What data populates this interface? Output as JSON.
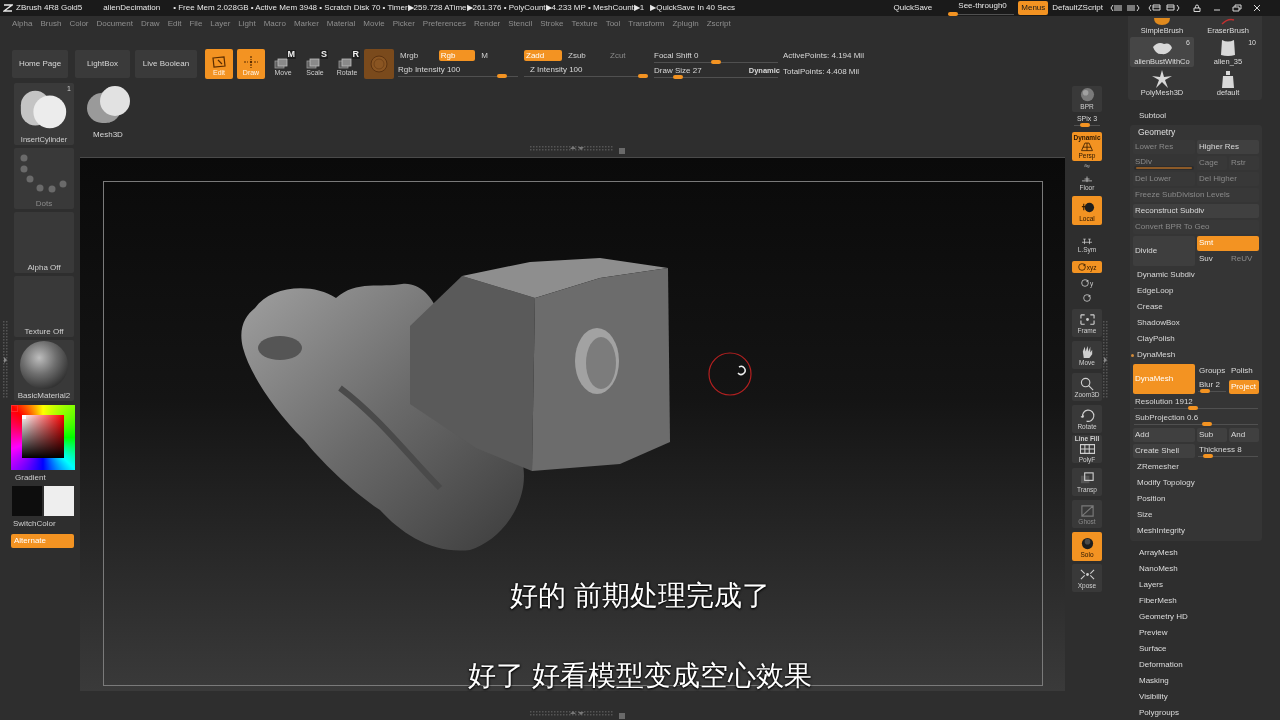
{
  "title_bar": {
    "app": "ZBrush 4R8 Gold5",
    "document": "alienDecimation",
    "stats": "• Free Mem 2.028GB • Active Mem 3948 • Scratch Disk 70 • Timer▶259.728 ATime▶261.376 • PolyCount▶4.233 MP • MeshCount▶1",
    "autosave": "▶QuickSave In 40 Secs",
    "quicksave": "QuickSave",
    "see_through": {
      "label": "See-through",
      "value": "0",
      "level": 0
    },
    "menus": {
      "label": "Menus",
      "on": true
    },
    "script": "DefaultZScript"
  },
  "menu_bar": [
    "Alpha",
    "Brush",
    "Color",
    "Document",
    "Draw",
    "Edit",
    "File",
    "Layer",
    "Light",
    "Macro",
    "Marker",
    "Material",
    "Movie",
    "Picker",
    "Preferences",
    "Render",
    "Stencil",
    "Stroke",
    "Texture",
    "Tool",
    "Transform",
    "Zplugin",
    "Zscript"
  ],
  "top_shelf": {
    "buttons": [
      "Home Page",
      "LightBox",
      "Live Boolean"
    ],
    "modes": [
      {
        "label": "Edit",
        "kind": "edit",
        "on": true
      },
      {
        "label": "Draw",
        "kind": "draw",
        "on": true
      },
      {
        "label": "Move",
        "kind": "move",
        "badge": "M",
        "on": false
      },
      {
        "label": "Scale",
        "kind": "scale",
        "badge": "S",
        "on": false
      },
      {
        "label": "Rotate",
        "kind": "rotate",
        "badge": "R",
        "on": false
      }
    ],
    "color_modes": [
      {
        "label": "Mrgb",
        "on": false,
        "disabled": false
      },
      {
        "label": "Rgb",
        "on": true,
        "disabled": false
      },
      {
        "label": "M",
        "on": false,
        "disabled": false
      }
    ],
    "rgb_intensity": {
      "label": "Rgb Intensity 100",
      "level": 0.9
    },
    "z_modes": [
      {
        "label": "Zadd",
        "on": true,
        "disabled": false
      },
      {
        "label": "Zsub",
        "on": false,
        "disabled": false
      },
      {
        "label": "Zcut",
        "on": false,
        "disabled": true
      }
    ],
    "z_intensity": {
      "label": "Z Intensity 100",
      "level": 1
    },
    "focal_shift": {
      "label": "Focal Shift 0",
      "level": 0.5
    },
    "draw_size": {
      "label": "Draw Size 27",
      "tag": "Dynamic",
      "level": 0.17
    },
    "stats": [
      "ActivePoints: 4.194 Mil",
      "TotalPoints: 4.408 Mil"
    ]
  },
  "brush": {
    "label": "InsertCylinder",
    "count": "1"
  },
  "tool": {
    "label": "Mesh3D"
  },
  "left_tray": {
    "stroke": "Dots",
    "alpha": "Alpha Off",
    "texture": "Texture Off",
    "material": "BasicMaterial2",
    "gradient": "Gradient",
    "swatches": [
      {
        "color": "#0d0d0d"
      },
      {
        "color": "#eeeeee"
      }
    ],
    "switch_color": "SwitchColor",
    "alternate": {
      "label": "Alternate",
      "on": true
    }
  },
  "canvas": {
    "subtitles": [
      "好的 前期处理完成了",
      "好了 好看模型变成空心效果"
    ]
  },
  "right_shelf": [
    {
      "kind": "bpr",
      "label": "BPR",
      "on": false,
      "disabled": false
    },
    {
      "kind": "slider",
      "label": "SPix 3",
      "level": 0.35
    },
    {
      "kind": "persp",
      "tag": "Dynamic",
      "label": "Persp",
      "on": true,
      "disabled": false
    },
    {
      "kind": "mini",
      "on": false,
      "disabled": false
    },
    {
      "kind": "floor",
      "label": "Floor",
      "on": false,
      "disabled": false
    },
    {
      "kind": "local",
      "label": "Local",
      "on": true,
      "disabled": false
    },
    {
      "kind": "lsym",
      "label": "L.Sym",
      "on": false,
      "disabled": false
    },
    {
      "kind": "xyz",
      "label": "xyz",
      "on": true,
      "disabled": false
    },
    {
      "kind": "y",
      "label": "y",
      "on": false,
      "disabled": false
    },
    {
      "kind": "z",
      "on": false,
      "disabled": false
    },
    {
      "kind": "frame",
      "label": "Frame",
      "on": false,
      "disabled": false
    },
    {
      "kind": "move",
      "label": "Move",
      "on": false,
      "disabled": false
    },
    {
      "kind": "zoom",
      "label": "Zoom3D",
      "on": false,
      "disabled": false
    },
    {
      "kind": "rotate",
      "label": "Rotate",
      "on": false,
      "disabled": false
    },
    {
      "kind": "polyf",
      "tag": "Line Fill",
      "label": "PolyF",
      "on": false,
      "disabled": false
    },
    {
      "kind": "transp",
      "label": "Transp",
      "on": false,
      "disabled": false
    },
    {
      "kind": "ghost",
      "label": "Ghost",
      "on": false,
      "disabled": true
    },
    {
      "kind": "solo",
      "label": "Solo",
      "on": true,
      "disabled": false
    },
    {
      "kind": "xpose",
      "label": "Xpose",
      "on": false,
      "disabled": false
    }
  ],
  "tool_palette": [
    {
      "label": "SimpleBrush",
      "kind": "simple_brush",
      "selected": false
    },
    {
      "label": "EraserBrush",
      "kind": "eraser",
      "selected": false
    },
    {
      "label": "alienBustWithCo",
      "count": "6",
      "kind": "bust",
      "selected": true
    },
    {
      "label": "alien_35",
      "count": "10",
      "kind": "torso",
      "selected": false
    },
    {
      "label": "PolyMesh3D",
      "kind": "star",
      "selected": false
    },
    {
      "label": "default",
      "kind": "figure",
      "selected": false
    }
  ],
  "subtool": "Subtool",
  "geometry": {
    "title": "Geometry",
    "rows": [
      {
        "kind": "cells",
        "cells": [
          {
            "kind": "button",
            "label": "Lower Res",
            "on": false,
            "disabled": true
          },
          {
            "kind": "button",
            "label": "Higher Res",
            "on": false,
            "disabled": false
          }
        ]
      },
      {
        "kind": "cells",
        "cells": [
          {
            "kind": "slider",
            "label": "SDiv",
            "level": 1,
            "disabled": true
          },
          {
            "kind": "button",
            "label": "Cage",
            "on": false,
            "disabled": true
          },
          {
            "kind": "button",
            "label": "Rstr",
            "on": false,
            "disabled": true
          }
        ]
      },
      {
        "kind": "cells",
        "cells": [
          {
            "kind": "button",
            "label": "Del Lower",
            "on": false,
            "disabled": true
          },
          {
            "kind": "button",
            "label": "Del Higher",
            "on": false,
            "disabled": true
          }
        ]
      },
      {
        "kind": "cells",
        "cells": [
          {
            "kind": "button",
            "label": "Freeze SubDivision Levels",
            "on": false,
            "disabled": true
          }
        ]
      },
      {
        "kind": "cells",
        "cells": [
          {
            "kind": "button",
            "label": "Reconstruct Subdiv",
            "on": false,
            "disabled": false
          }
        ]
      },
      {
        "kind": "cells",
        "cells": [
          {
            "kind": "button",
            "label": "Convert BPR To Geo",
            "on": false,
            "disabled": true
          }
        ]
      },
      {
        "kind": "block",
        "main": {
          "label": "Divide",
          "on": false,
          "disabled": false
        },
        "top": [
          {
            "kind": "toggle",
            "label": "Smt",
            "on": true,
            "disabled": false
          }
        ],
        "bottom": [
          {
            "kind": "toggle",
            "label": "Suv",
            "on": false,
            "disabled": false
          },
          {
            "kind": "toggle",
            "label": "ReUV",
            "on": false,
            "disabled": true
          }
        ]
      },
      {
        "kind": "subpalette",
        "label": "Dynamic Subdiv",
        "expanded": false
      },
      {
        "kind": "subpalette",
        "label": "EdgeLoop",
        "expanded": false
      },
      {
        "kind": "subpalette",
        "label": "Crease",
        "expanded": false
      },
      {
        "kind": "subpalette",
        "label": "ShadowBox",
        "expanded": false
      },
      {
        "kind": "subpalette",
        "label": "ClayPolish",
        "expanded": false
      },
      {
        "kind": "subpalette",
        "label": "DynaMesh",
        "expanded": true
      },
      {
        "kind": "block",
        "main": {
          "label": "DynaMesh",
          "on": true,
          "disabled": false
        },
        "top": [
          {
            "kind": "toggle",
            "label": "Groups",
            "on": false,
            "disabled": false
          },
          {
            "kind": "toggle",
            "label": "Polish",
            "on": false,
            "disabled": false
          }
        ],
        "bottom": [
          {
            "kind": "slider",
            "label": "Blur 2",
            "level": 0.1,
            "disabled": false
          },
          {
            "kind": "toggle",
            "label": "Project",
            "on": true,
            "disabled": false
          }
        ]
      },
      {
        "kind": "cells",
        "cells": [
          {
            "kind": "slider",
            "label": "Resolution 1912",
            "level": 0.47,
            "disabled": false
          }
        ]
      },
      {
        "kind": "cells",
        "cells": [
          {
            "kind": "slider",
            "label": "SubProjection 0.6",
            "level": 0.6,
            "disabled": false
          }
        ]
      },
      {
        "kind": "cells",
        "cells": [
          {
            "kind": "button",
            "label": "Add",
            "on": false,
            "disabled": false
          },
          {
            "kind": "button",
            "label": "Sub",
            "on": false,
            "disabled": false
          },
          {
            "kind": "button",
            "label": "And",
            "on": false,
            "disabled": false
          }
        ]
      },
      {
        "kind": "cells",
        "cells": [
          {
            "kind": "button",
            "label": "Create Shell",
            "on": false,
            "disabled": false
          },
          {
            "kind": "slider",
            "label": "Thickness 8",
            "level": 0.1,
            "disabled": false
          }
        ]
      },
      {
        "kind": "subpalette",
        "label": "ZRemesher",
        "expanded": false
      },
      {
        "kind": "subpalette",
        "label": "Modify Topology",
        "expanded": false
      },
      {
        "kind": "subpalette",
        "label": "Position",
        "expanded": false
      },
      {
        "kind": "subpalette",
        "label": "Size",
        "expanded": false
      },
      {
        "kind": "subpalette",
        "label": "MeshIntegrity",
        "expanded": false
      }
    ]
  },
  "palettes": [
    "ArrayMesh",
    "NanoMesh",
    "Layers",
    "FiberMesh",
    "Geometry HD",
    "Preview",
    "Surface",
    "Deformation",
    "Masking",
    "Visibility",
    "Polygroups"
  ]
}
